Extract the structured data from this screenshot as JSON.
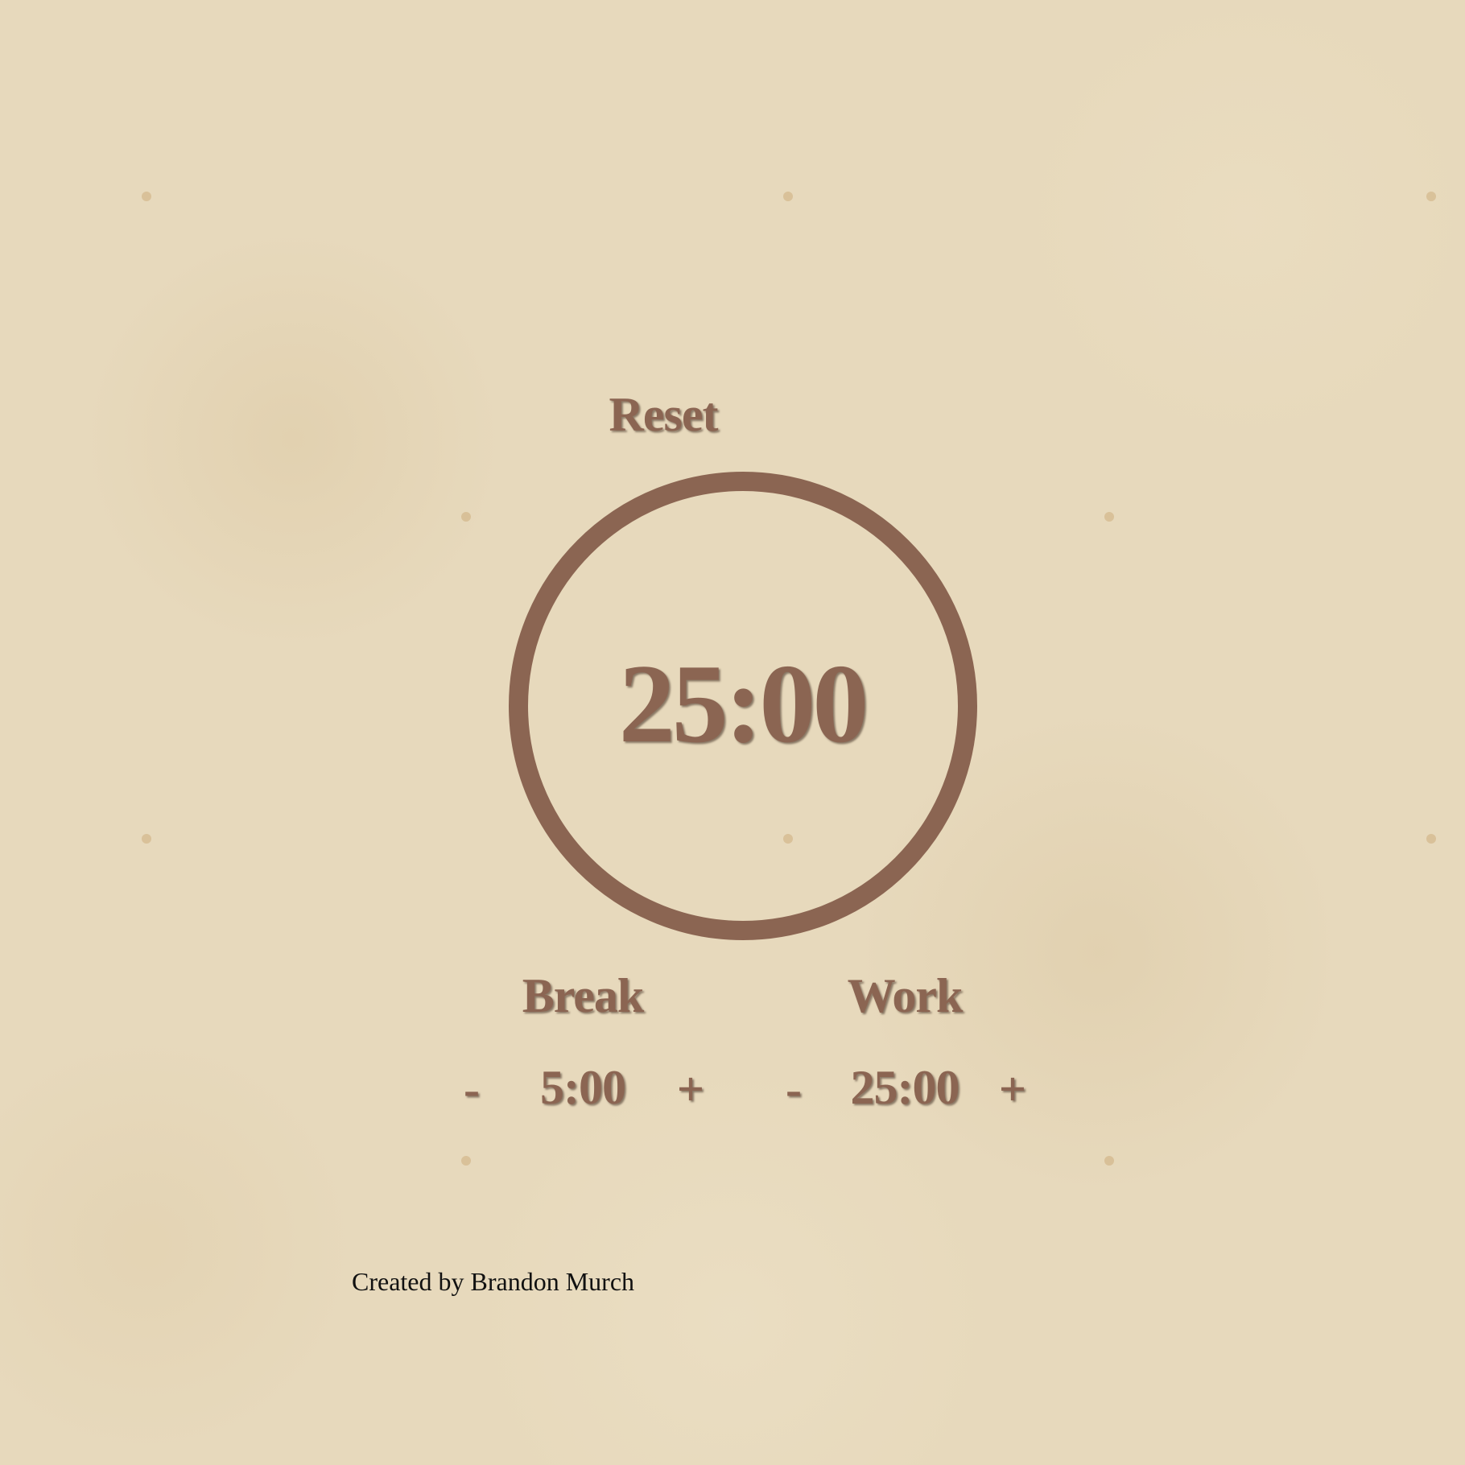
{
  "timer": {
    "reset_label": "Reset",
    "display": "25:00"
  },
  "break": {
    "label": "Break",
    "value": "5:00",
    "decrement_label": "-",
    "increment_label": "+"
  },
  "work": {
    "label": "Work",
    "value": "25:00",
    "decrement_label": "-",
    "increment_label": "+"
  },
  "footer": {
    "credit": "Created by Brandon Murch"
  },
  "colors": {
    "background": "#e7d9bc",
    "accent": "#8b6552",
    "credit_text": "#111111"
  }
}
